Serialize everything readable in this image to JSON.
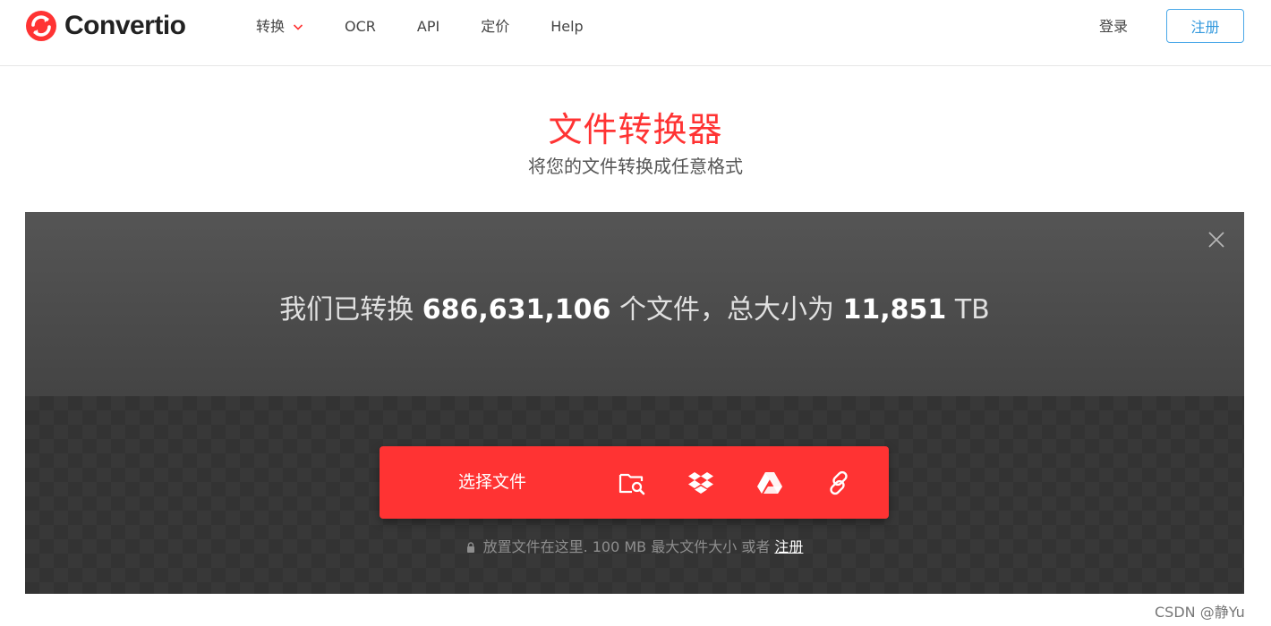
{
  "brand": {
    "name": "Convertio",
    "color": "#ff3333"
  },
  "nav": {
    "items": [
      {
        "label": "转换",
        "has_dropdown": true
      },
      {
        "label": "OCR"
      },
      {
        "label": "API"
      },
      {
        "label": "定价"
      },
      {
        "label": "Help"
      }
    ],
    "login_label": "登录",
    "signup_label": "注册"
  },
  "hero": {
    "title": "文件转换器",
    "subtitle": "将您的文件转换成任意格式"
  },
  "converter": {
    "stats": {
      "prefix": "我们已转换",
      "files_count": "686,631,106",
      "middle": "个文件，总大小为",
      "total_size": "11,851",
      "unit": "TB"
    },
    "choose_label": "选择文件",
    "sources": [
      "folder-search-icon",
      "dropbox-icon",
      "google-drive-icon",
      "link-icon"
    ],
    "footnote": {
      "text": "放置文件在这里. 100 MB 最大文件大小 或者",
      "link": "注册"
    }
  },
  "watermark": "CSDN @静Yu",
  "colors": {
    "accent": "#ff3333",
    "signup": "#3399dd",
    "panel_dark": "#444444"
  }
}
